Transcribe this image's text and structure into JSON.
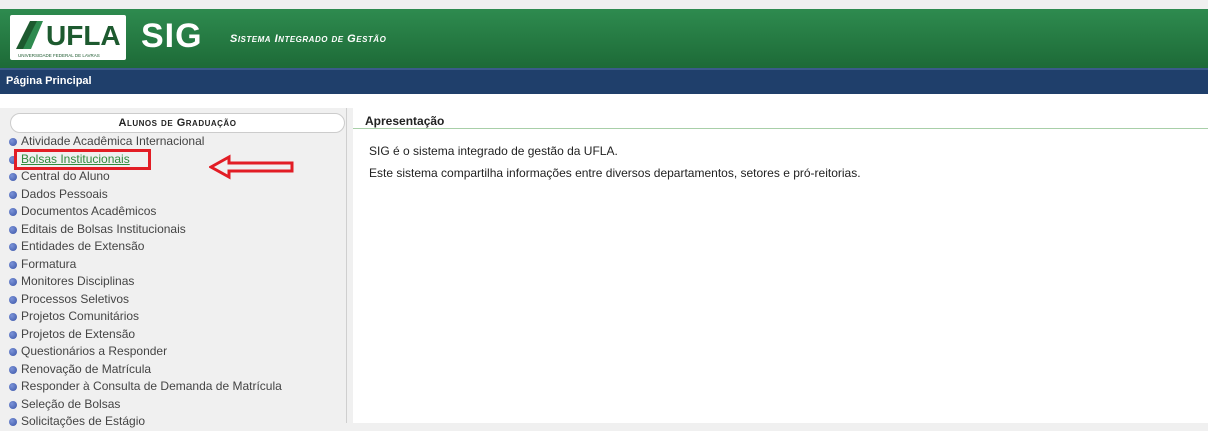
{
  "header": {
    "logo_text": "UFLA",
    "logo_subtext": "UNIVERSIDADE FEDERAL DE LAVRAS",
    "app_title": "SIG",
    "subtitle": "Sistema Integrado de Gestão"
  },
  "navbar": {
    "label": "Página Principal"
  },
  "sidebar": {
    "title": "Alunos de Graduação",
    "items": [
      "Atividade Acadêmica Internacional",
      "Bolsas Institucionais",
      "Central do Aluno",
      "Dados Pessoais",
      "Documentos Acadêmicos",
      "Editais de Bolsas Institucionais",
      "Entidades de Extensão",
      "Formatura",
      "Monitores Disciplinas",
      "Processos Seletivos",
      "Projetos Comunitários",
      "Projetos de Extensão",
      "Questionários a Responder",
      "Renovação de Matrícula",
      "Responder à Consulta de Demanda de Matrícula",
      "Seleção de Bolsas",
      "Solicitações de Estágio"
    ],
    "highlighted_index": 1
  },
  "content": {
    "title": "Apresentação",
    "paragraphs": [
      "SIG é o sistema integrado de gestão da UFLA.",
      "Este sistema compartilha informações entre diversos departamentos, setores e pró-reitorias."
    ]
  },
  "colors": {
    "header_green": "#1d6a37",
    "navbar_blue": "#1f3f6b",
    "highlight_red": "#e21d25",
    "link_green": "#2f8a3c"
  }
}
